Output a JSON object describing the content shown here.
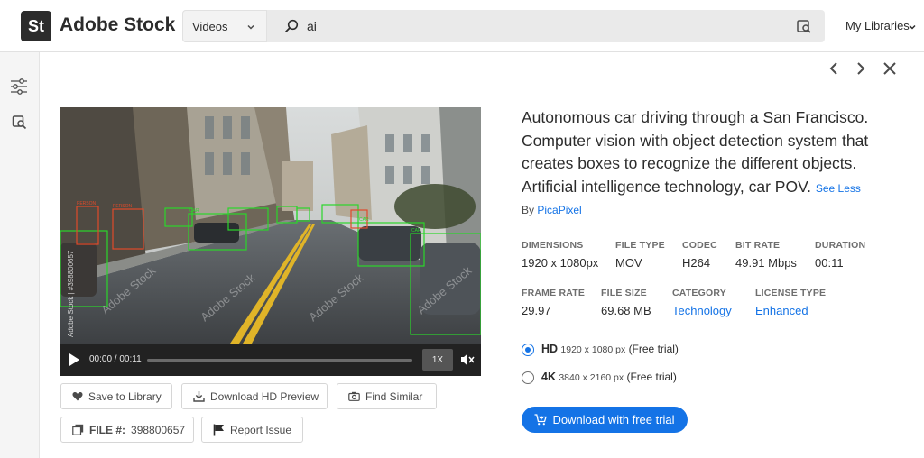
{
  "header": {
    "logo_text": "St",
    "brand": "Adobe Stock",
    "search_type": "Videos",
    "search_query": "ai",
    "my_libraries": "My Libraries"
  },
  "player": {
    "time": "00:00 / 00:11",
    "speed": "1X",
    "progress": 0
  },
  "actions": {
    "save": "Save to Library",
    "download_preview": "Download HD Preview",
    "find_similar": "Find Similar",
    "file_label": "FILE #:",
    "file_number": "398800657",
    "report": "Report Issue"
  },
  "details": {
    "description": "Autonomous car driving through a San Francisco. Computer vision with object detection system that creates boxes to recognize the different objects. Artificial intelligence technology, car POV.",
    "see_less": "See Less",
    "by": "By",
    "author": "PicaPixel",
    "meta_row1": [
      {
        "label": "DIMENSIONS",
        "value": "1920 x 1080px"
      },
      {
        "label": "FILE TYPE",
        "value": "MOV"
      },
      {
        "label": "CODEC",
        "value": "H264"
      },
      {
        "label": "BIT RATE",
        "value": "49.91 Mbps"
      },
      {
        "label": "DURATION",
        "value": "00:11"
      }
    ],
    "meta_row2": [
      {
        "label": "FRAME RATE",
        "value": "29.97"
      },
      {
        "label": "FILE SIZE",
        "value": "69.68 MB"
      },
      {
        "label": "CATEGORY",
        "value": "Technology"
      },
      {
        "label": "LICENSE TYPE",
        "value": "Enhanced"
      }
    ],
    "resolutions": [
      {
        "name": "HD",
        "dims": "1920 x 1080 px",
        "note": "(Free trial)",
        "selected": true
      },
      {
        "name": "4K",
        "dims": "3840 x 2160 px",
        "note": "(Free trial)",
        "selected": false
      }
    ],
    "download_button": "Download with free trial"
  },
  "video_overlay": {
    "watermark_id": "Adobe Stock | #398800657",
    "watermark_brand": "Adobe Stock",
    "detection_labels": [
      "PERSON",
      "PERSON",
      "CAR",
      "CAR",
      "CAR"
    ]
  },
  "colors": {
    "accent": "#1473e6",
    "detection_green": "#2bd62b",
    "detection_red": "#e04a2a"
  }
}
